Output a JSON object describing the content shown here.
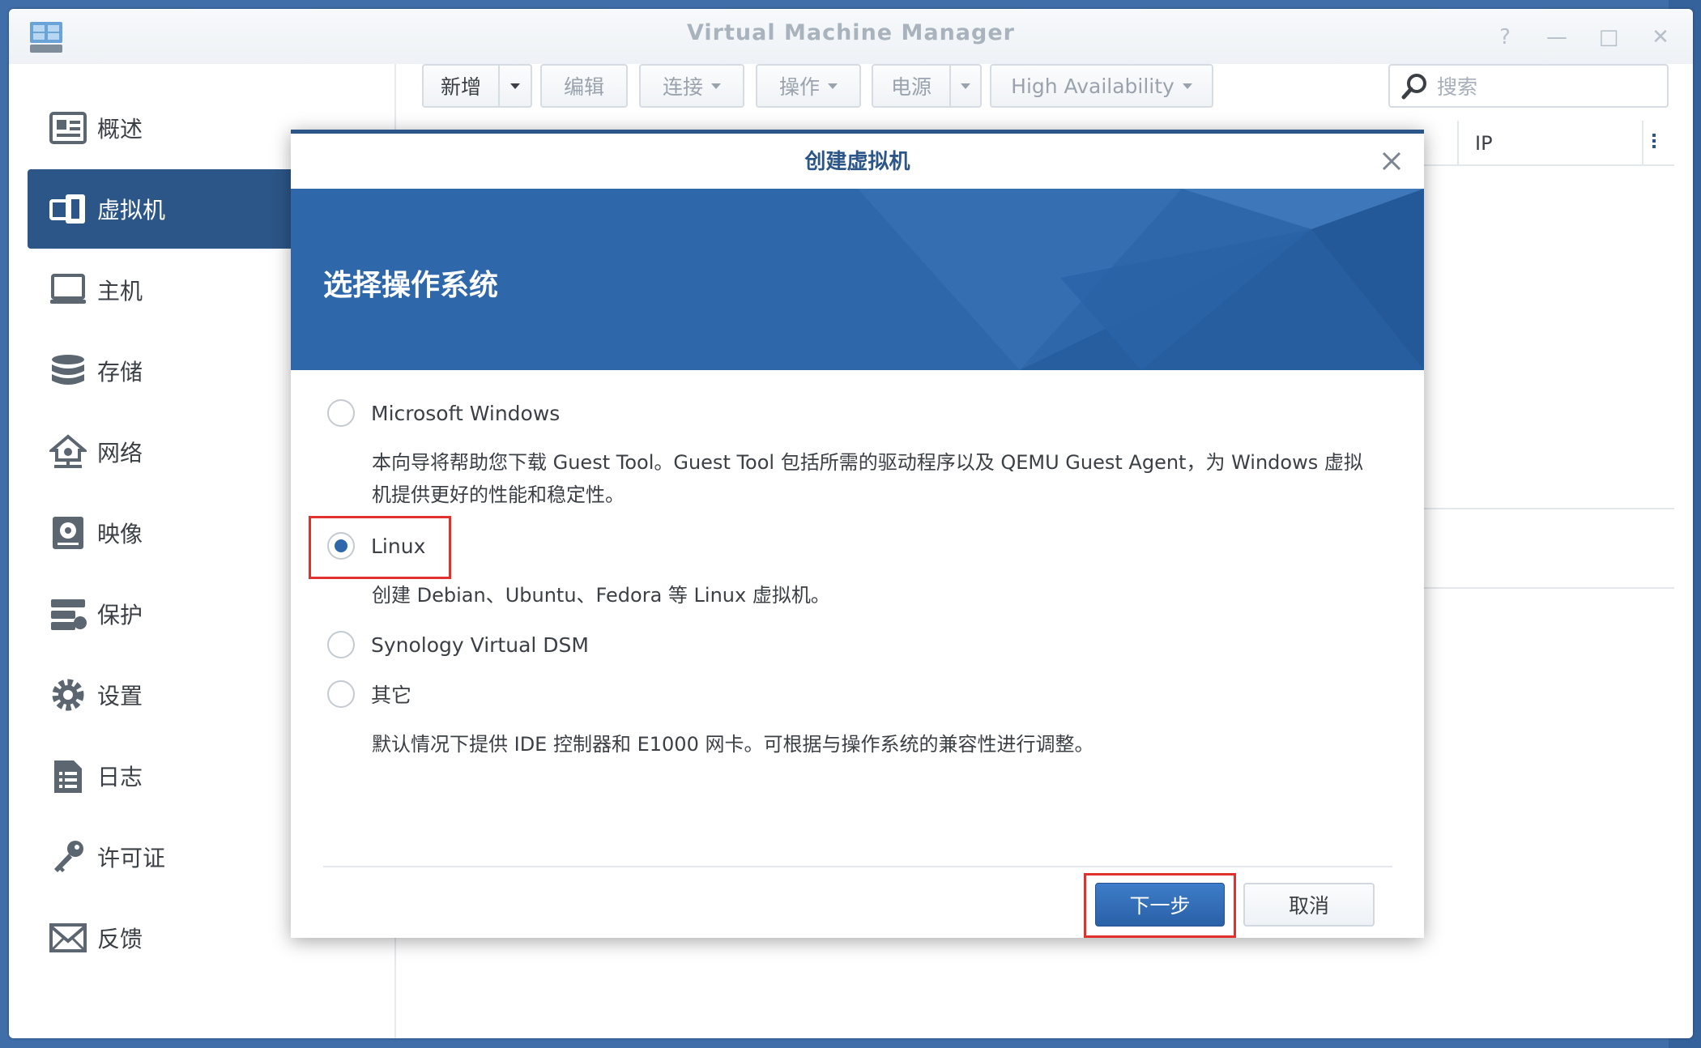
{
  "window": {
    "title": "Virtual Machine Manager",
    "controls": {
      "help": "?",
      "minimize": "—",
      "maximize": "□",
      "close": "✕"
    }
  },
  "sidebar": {
    "items": [
      {
        "label": "概述",
        "icon": "overview-icon",
        "active": false
      },
      {
        "label": "虚拟机",
        "icon": "virtual-machine-icon",
        "active": true
      },
      {
        "label": "主机",
        "icon": "host-icon",
        "active": false
      },
      {
        "label": "存储",
        "icon": "storage-icon",
        "active": false
      },
      {
        "label": "网络",
        "icon": "network-icon",
        "active": false
      },
      {
        "label": "映像",
        "icon": "image-icon",
        "active": false
      },
      {
        "label": "保护",
        "icon": "protection-icon",
        "active": false
      },
      {
        "label": "设置",
        "icon": "settings-icon",
        "active": false
      },
      {
        "label": "日志",
        "icon": "log-icon",
        "active": false
      },
      {
        "label": "许可证",
        "icon": "license-icon",
        "active": false
      },
      {
        "label": "反馈",
        "icon": "feedback-icon",
        "active": false
      }
    ]
  },
  "toolbar": {
    "create": "新增",
    "edit": "编辑",
    "connect": "连接",
    "action": "操作",
    "power": "电源",
    "high_availability": "High Availability"
  },
  "search": {
    "placeholder": "搜索"
  },
  "grid": {
    "column_ip": "IP"
  },
  "dialog": {
    "title": "创建虚拟机",
    "banner_title": "选择操作系统",
    "options": [
      {
        "label": "Microsoft Windows",
        "checked": false,
        "description": "本向导将帮助您下载 Guest Tool。Guest Tool 包括所需的驱动程序以及 QEMU Guest Agent，为 Windows 虚拟机提供更好的性能和稳定性。"
      },
      {
        "label": "Linux",
        "checked": true,
        "description": "创建 Debian、Ubuntu、Fedora 等 Linux 虚拟机。"
      },
      {
        "label": "Synology Virtual DSM",
        "checked": false,
        "description": ""
      },
      {
        "label": "其它",
        "checked": false,
        "description": "默认情况下提供 IDE 控制器和 E1000 网卡。可根据与操作系统的兼容性进行调整。"
      }
    ],
    "next_button": "下一步",
    "cancel_button": "取消"
  },
  "colors": {
    "accent": "#2c5688",
    "banner": "#2f67ab",
    "highlight": "#e1312e"
  }
}
